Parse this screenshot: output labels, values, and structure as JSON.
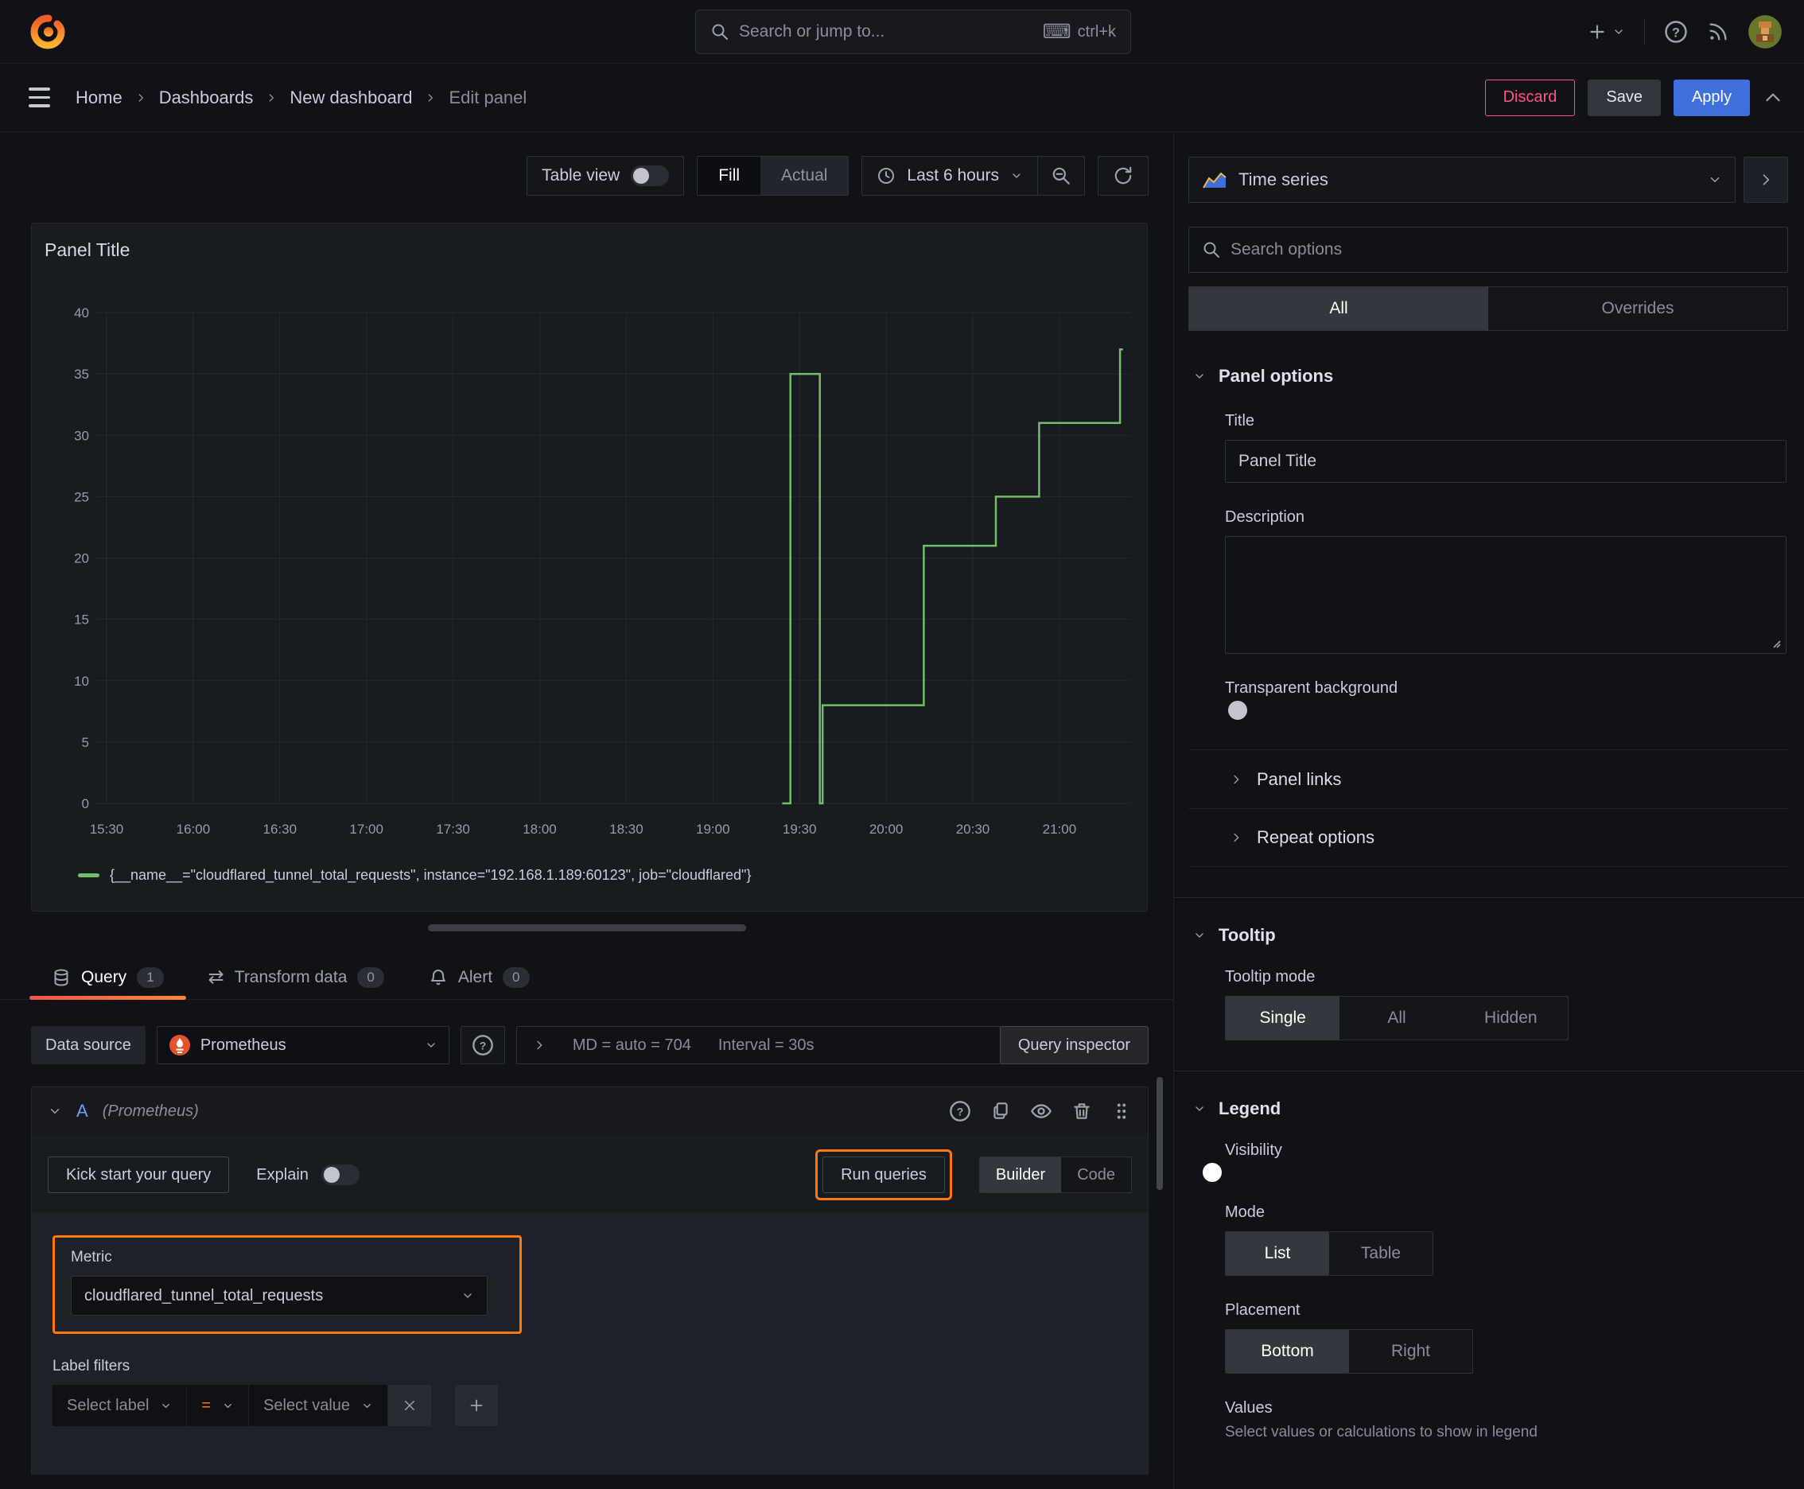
{
  "topbar": {
    "search_placeholder": "Search or jump to...",
    "shortcut": "ctrl+k"
  },
  "breadcrumb": {
    "items": [
      "Home",
      "Dashboards",
      "New dashboard",
      "Edit panel"
    ],
    "discard": "Discard",
    "save": "Save",
    "apply": "Apply"
  },
  "toolbar": {
    "table_view": "Table view",
    "fill": "Fill",
    "actual": "Actual",
    "time_range": "Last 6 hours"
  },
  "tabs": {
    "query": "Query",
    "query_count": "1",
    "transform": "Transform data",
    "transform_count": "0",
    "alert": "Alert",
    "alert_count": "0"
  },
  "datasource": {
    "label": "Data source",
    "name": "Prometheus",
    "stats": "MD = auto = 704",
    "interval": "Interval = 30s",
    "inspector": "Query inspector"
  },
  "query": {
    "ref": "A",
    "ds_hint": "(Prometheus)",
    "kickstart": "Kick start your query",
    "explain": "Explain",
    "run": "Run queries",
    "builder": "Builder",
    "code": "Code",
    "metric_label": "Metric",
    "metric_value": "cloudflared_tunnel_total_requests",
    "filters_label": "Label filters",
    "select_label": "Select label",
    "operator": "=",
    "select_value": "Select value"
  },
  "options": {
    "viz_type": "Time series",
    "search_placeholder": "Search options",
    "tab_all": "All",
    "tab_overrides": "Overrides",
    "panel_options": "Panel options",
    "title_label": "Title",
    "title_value": "Panel Title",
    "description_label": "Description",
    "transparent_label": "Transparent background",
    "panel_links": "Panel links",
    "repeat_options": "Repeat options",
    "tooltip": "Tooltip",
    "tooltip_mode": "Tooltip mode",
    "tip_single": "Single",
    "tip_all": "All",
    "tip_hidden": "Hidden",
    "legend": "Legend",
    "visibility": "Visibility",
    "mode": "Mode",
    "mode_list": "List",
    "mode_table": "Table",
    "placement": "Placement",
    "place_bottom": "Bottom",
    "place_right": "Right",
    "values_label": "Values",
    "values_help": "Select values or calculations to show in legend"
  },
  "chart_data": {
    "type": "line",
    "title": "Panel Title",
    "x_ticks": [
      "15:30",
      "16:00",
      "16:30",
      "17:00",
      "17:30",
      "18:00",
      "18:30",
      "19:00",
      "19:30",
      "20:00",
      "20:30",
      "21:00"
    ],
    "y_ticks": [
      0,
      5,
      10,
      15,
      20,
      25,
      30,
      35,
      40
    ],
    "ylim": [
      0,
      40
    ],
    "x_range_hours": [
      15.5,
      21.42
    ],
    "grid": true,
    "legend_position": "bottom",
    "series": [
      {
        "name": "{__name__=\"cloudflared_tunnel_total_requests\", instance=\"192.168.1.189:60123\", job=\"cloudflared\"}",
        "color": "#73bf69",
        "points_time_value": [
          [
            19.4,
            0
          ],
          [
            19.447,
            0
          ],
          [
            19.447,
            35
          ],
          [
            19.617,
            35
          ],
          [
            19.617,
            0
          ],
          [
            19.633,
            0
          ],
          [
            19.633,
            8
          ],
          [
            20.217,
            8
          ],
          [
            20.217,
            21
          ],
          [
            20.633,
            21
          ],
          [
            20.633,
            25
          ],
          [
            20.883,
            25
          ],
          [
            20.883,
            31
          ],
          [
            21.35,
            31
          ],
          [
            21.35,
            37
          ],
          [
            21.367,
            37
          ]
        ]
      }
    ]
  }
}
